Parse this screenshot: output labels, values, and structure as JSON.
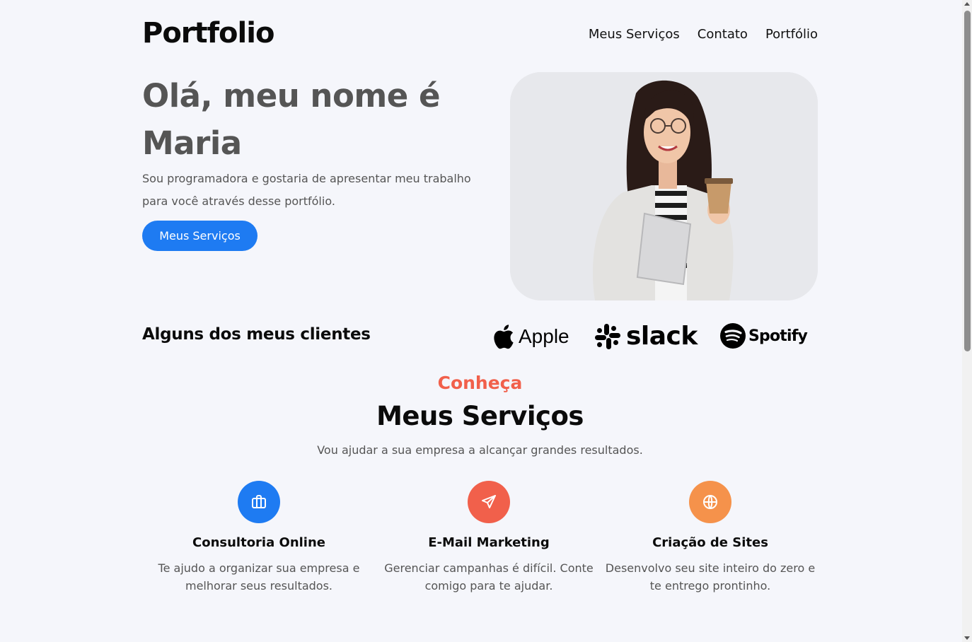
{
  "header": {
    "logo": "Portfolio",
    "nav": [
      "Meus Serviços",
      "Contato",
      "Portfólio"
    ]
  },
  "hero": {
    "title": "Olá, meu nome é Maria",
    "text": "Sou programadora e gostaria de apresentar meu trabalho para você através desse portfólio.",
    "button": "Meus Serviços",
    "photo_icon": "woman-portrait"
  },
  "clients": {
    "title": "Alguns dos meus clientes",
    "logos": [
      {
        "name": "Apple",
        "icon": "apple-logo-icon"
      },
      {
        "name": "slack",
        "icon": "slack-logo-icon"
      },
      {
        "name": "Spotify",
        "icon": "spotify-logo-icon"
      }
    ]
  },
  "services": {
    "eyebrow": "Conheça",
    "title": "Meus Serviços",
    "subtitle": "Vou ajudar a sua empresa a alcançar grandes resultados.",
    "items": [
      {
        "title": "Consultoria Online",
        "text": "Te ajudo a organizar sua empresa e melhorar seus resultados.",
        "icon": "briefcase-icon",
        "color": "#1e7bf2"
      },
      {
        "title": "E-Mail Marketing",
        "text": "Gerenciar campanhas é difícil. Conte comigo para te ajudar.",
        "icon": "send-icon",
        "color": "#f1604b"
      },
      {
        "title": "Criação de Sites",
        "text": "Desenvolvo seu site inteiro do zero e te entrego prontinho.",
        "icon": "globe-icon",
        "color": "#f5924b"
      }
    ]
  },
  "colors": {
    "background": "#f5f6fb",
    "accent": "#1e7bf2",
    "eyebrow": "#f1604b"
  }
}
